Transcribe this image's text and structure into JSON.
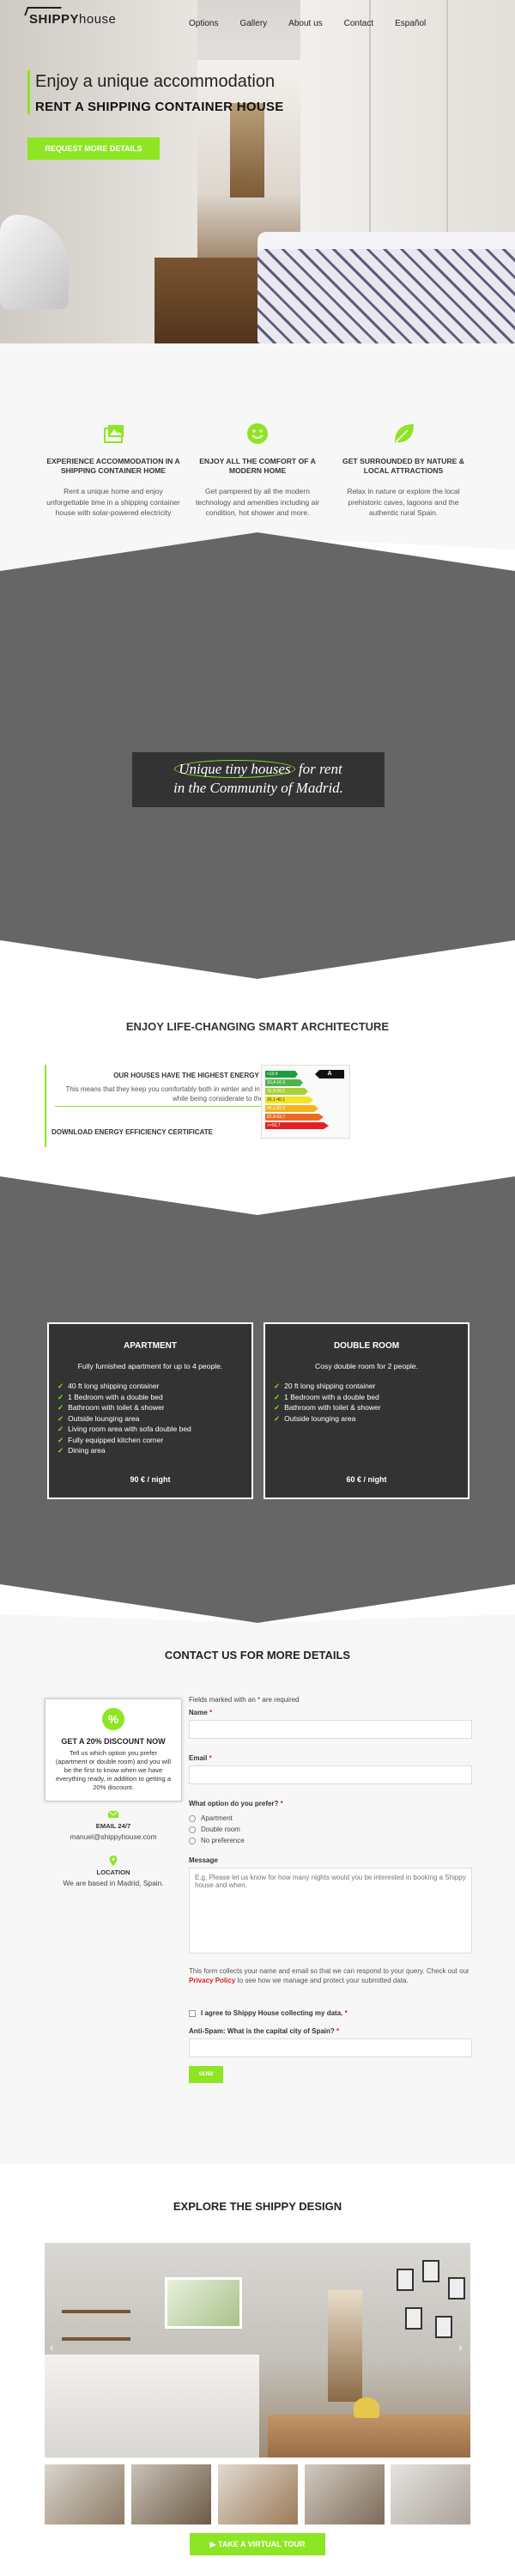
{
  "nav": {
    "logo_bold": "SHIPPY",
    "logo_light": "house",
    "links": [
      "Options",
      "Gallery",
      "About us",
      "Contact",
      "Español"
    ]
  },
  "hero": {
    "headline": "Enjoy a unique accommodation",
    "subheadline": "RENT A SHIPPING CONTAINER HOUSE",
    "button": "REQUEST MORE DETAILS"
  },
  "features": [
    {
      "icon": "image-gallery-icon",
      "title": "EXPERIENCE ACCOMMODATION IN A SHIPPING CONTAINER HOME",
      "desc": "Rent a unique home and enjoy unforgettable time in a shipping container house with solar-powered electricity"
    },
    {
      "icon": "smiley-icon",
      "title": "ENJOY ALL THE COMFORT OF A MODERN HOME",
      "desc": "Get pampered by all the modern technology and amenities including air condition, hot shower and more."
    },
    {
      "icon": "leaf-icon",
      "title": "GET SURROUNDED BY NATURE & LOCAL ATTRACTIONS",
      "desc": "Relax in nature or explore the local prehistoric caves, lagoons and the authentic rural Spain."
    }
  ],
  "quote": {
    "highlight": "Unique tiny houses",
    "rest_line1": " for rent",
    "line2": "in the Community of Madrid."
  },
  "energy": {
    "section_title": "ENJOY LIFE-CHANGING SMART ARCHITECTURE",
    "box_title": "OUR HOUSES HAVE THE HIGHEST ENERGY RATING",
    "box_desc": "This means that they keep you comfortably both in winter and in summer while being considerate to the nature.",
    "download": "DOWNLOAD ENERGY EFFICIENCY CERTIFICATE",
    "rating": "A",
    "bars": [
      {
        "label": "<10,4",
        "color": "#1d9d3a"
      },
      {
        "label": "10,4-16,9",
        "color": "#4cb648"
      },
      {
        "label": "16,9-26,1",
        "color": "#a7d13a"
      },
      {
        "label": "26,1-40,1",
        "color": "#f1e525"
      },
      {
        "label": "40,1-82,9",
        "color": "#f5b41c"
      },
      {
        "label": "82,9-93,7",
        "color": "#ec6a24"
      },
      {
        "label": ">=93,7",
        "color": "#e12126"
      }
    ]
  },
  "options": [
    {
      "title": "APARTMENT",
      "subtitle": "Fully furnished apartment for up to 4 people.",
      "items": [
        "40 ft long shipping container",
        "1 Bedroom with a double bed",
        "Bathroom with toilet & shower",
        "Outside lounging area",
        "Living room area with sofa double bed",
        "Fully equipped kitchen corner",
        "Dining area"
      ],
      "price": "90 € / night"
    },
    {
      "title": "DOUBLE ROOM",
      "subtitle": "Cosy double room for 2 people.",
      "items": [
        "20 ft long shipping container",
        "1 Bedroom with a double bed",
        "Bathroom with toilet & shower",
        "Outside lounging area"
      ],
      "price": "60 € / night"
    }
  ],
  "contact": {
    "title": "CONTACT US FOR MORE DETAILS",
    "discount_pct": "%",
    "discount_title": "GET A 20% DISCOUNT NOW",
    "discount_desc": "Tell us which option you prefer (apartment or double room) and you will be the first to know when we have everything ready, in addition to getting a 20% discount.",
    "email_label": "EMAIL 24/7",
    "email_value": "manuel@shippyhouse.com",
    "location_label": "LOCATION",
    "location_value": "We are based in Madrid, Spain.",
    "required_note": "Fields marked with an * are required",
    "name_label": "Name",
    "email_field_label": "Email",
    "option_label": "What option do you prefer?",
    "option_choices": [
      "Apartment",
      "Double room",
      "No preference"
    ],
    "message_label": "Message",
    "message_placeholder": "E.g. Please let us know for how many nights would you be interested in booking a Shippy house and when.",
    "privacy_prefix": "This form collects your name and email so that we can respond to your query. Check out our ",
    "privacy_link": "Privacy Policy",
    "privacy_suffix": " to see how we manage and protect your submitted data.",
    "agree_label": "I agree to Shippy House collecting my data.",
    "antispam_label": "Anti-Spam: What is the capital city of Spain?",
    "send": "SEND"
  },
  "gallery": {
    "title": "EXPLORE THE SHIPPY DESIGN",
    "prev": "‹",
    "next": "›",
    "button": "TAKE A VIRTUAL TOUR"
  },
  "colors": {
    "accent": "#8ee524",
    "dark": "#333333",
    "grey_band": "#666666"
  }
}
